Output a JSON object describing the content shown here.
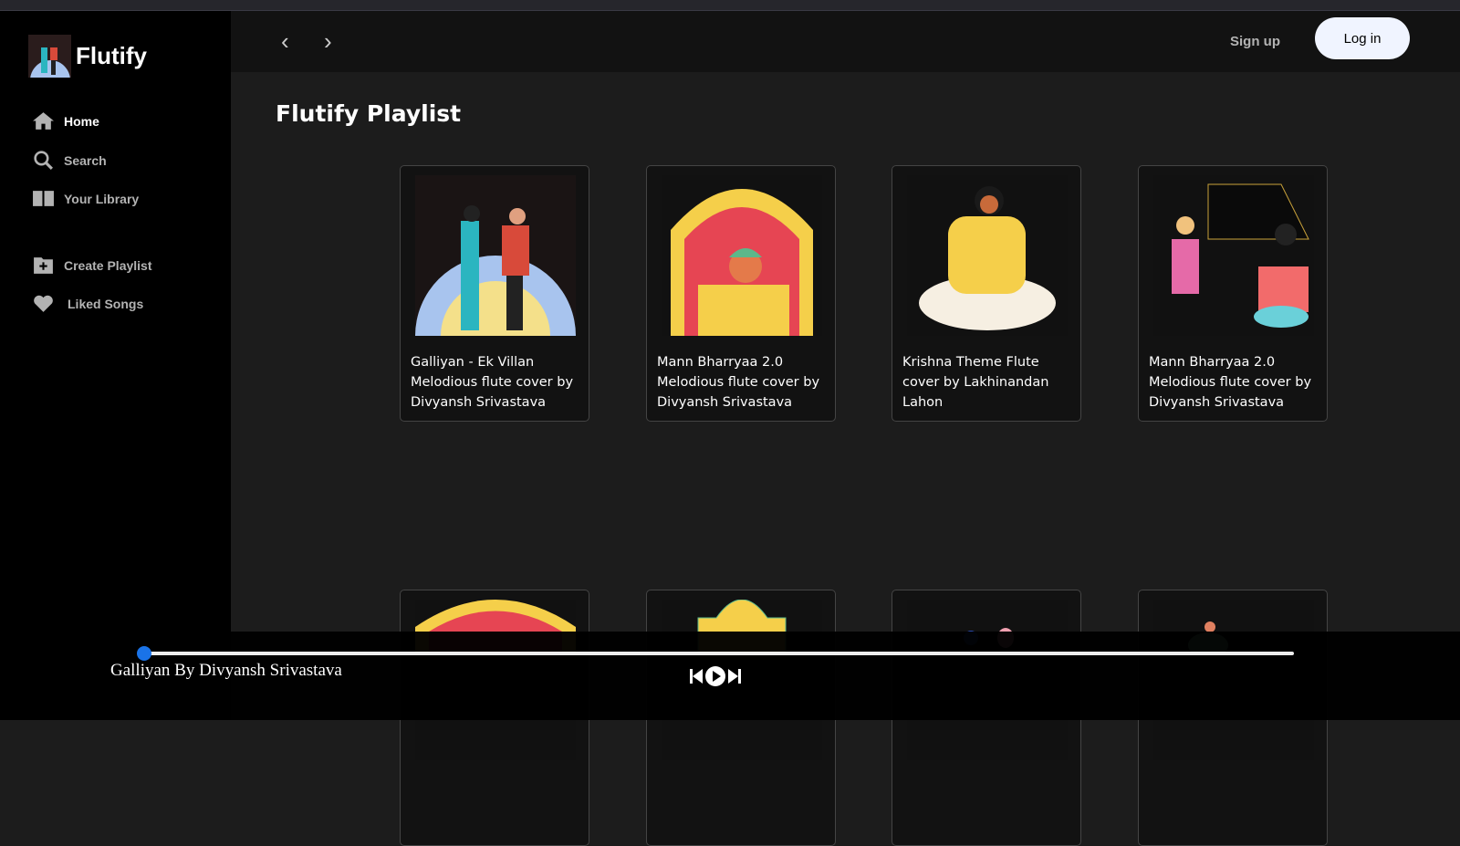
{
  "app": {
    "name": "Flutify"
  },
  "sidebar": {
    "items": [
      {
        "label": "Home",
        "icon": "home-icon"
      },
      {
        "label": "Search",
        "icon": "search-icon"
      },
      {
        "label": "Your Library",
        "icon": "library-icon"
      },
      {
        "label": "Create Playlist",
        "icon": "create-playlist-icon"
      },
      {
        "label": "Liked Songs",
        "icon": "heart-icon"
      }
    ]
  },
  "header": {
    "back": "‹",
    "forward": "›",
    "signup": "Sign up",
    "login": "Log in"
  },
  "main": {
    "title": "Flutify Playlist",
    "cards": [
      {
        "title": "Galliyan - Ek Villan Melodious flute cover by Divyansh Srivastava"
      },
      {
        "title": "Mann Bharryaa 2.0 Melodious flute cover by Divyansh Srivastava"
      },
      {
        "title": "Krishna Theme Flute cover by Lakhinandan Lahon"
      },
      {
        "title": "Mann Bharryaa 2.0 Melodious flute cover by Divyansh Srivastava"
      }
    ]
  },
  "player": {
    "song": "Galliyan By Divyansh Srivastava",
    "progress": 0,
    "accent": "#1a73e8"
  }
}
